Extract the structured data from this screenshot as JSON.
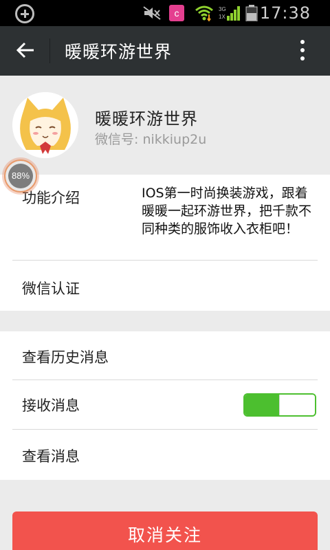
{
  "status_bar": {
    "time": "17:38",
    "app_icon_letter": "c",
    "network_label": "3G",
    "network_label2": "1X",
    "icons": [
      "add-circle-icon",
      "mute-icon",
      "app-icon",
      "wifi-icon",
      "signal-icon",
      "battery-icon"
    ]
  },
  "header": {
    "title": "暖暖环游世界",
    "back_icon": "arrow-left-icon",
    "more_icon": "more-vertical-icon"
  },
  "profile": {
    "name": "暖暖环游世界",
    "wechat_id": "微信号: nikkiup2u",
    "progress_badge": "88%"
  },
  "info": {
    "intro_label": "功能介绍",
    "intro_text": "IOS第一时尚换装游戏，跟着暖暖一起环游世界，把千款不同种类的服饰收入衣柜吧！",
    "verify_label": "微信认证"
  },
  "actions": {
    "history_label": "查看历史消息",
    "receive_label": "接收消息",
    "receive_enabled": true,
    "view_label": "查看消息"
  },
  "footer": {
    "unfollow_label": "取消关注"
  },
  "colors": {
    "header_bg": "#2d3133",
    "toggle_on": "#4cbf2f",
    "danger": "#f2534d"
  }
}
